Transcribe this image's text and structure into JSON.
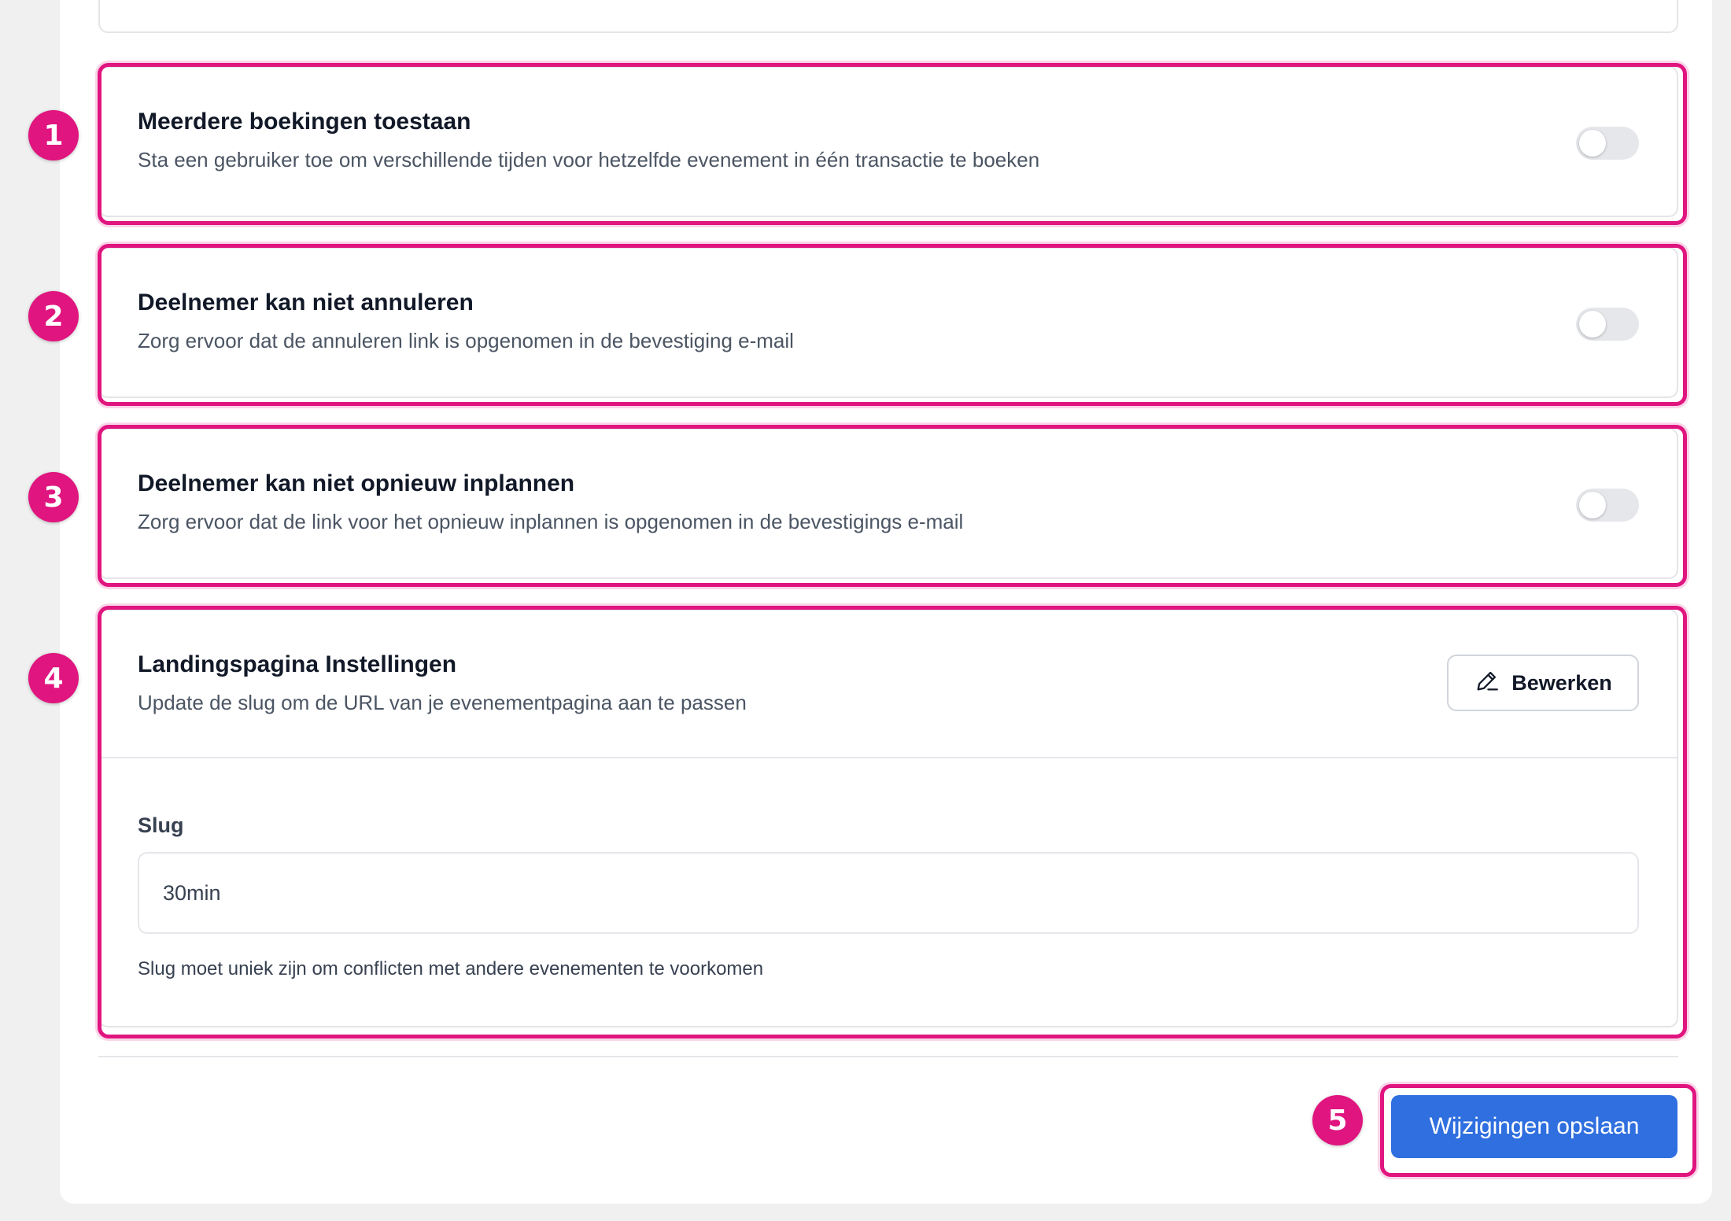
{
  "settings": [
    {
      "badge": "1",
      "title": "Meerdere boekingen toestaan",
      "description": "Sta een gebruiker toe om verschillende tijden voor hetzelfde evenement in één transactie te boeken",
      "enabled": false
    },
    {
      "badge": "2",
      "title": "Deelnemer kan niet annuleren",
      "description": "Zorg ervoor dat de annuleren link is opgenomen in de bevestiging e-mail",
      "enabled": false
    },
    {
      "badge": "3",
      "title": "Deelnemer kan niet opnieuw inplannen",
      "description": "Zorg ervoor dat de link voor het opnieuw inplannen is opgenomen in de bevestigings e-mail",
      "enabled": false
    }
  ],
  "landing": {
    "badge": "4",
    "title": "Landingspagina Instellingen",
    "description": "Update de slug om de URL van je evenementpagina aan te passen",
    "edit_label": "Bewerken",
    "slug_label": "Slug",
    "slug_value": "30min",
    "slug_hint": "Slug moet uniek zijn om conflicten met andere evenementen te voorkomen"
  },
  "footer": {
    "badge": "5",
    "save_label": "Wijzigingen opslaan"
  },
  "colors": {
    "highlight": "#e0157f",
    "primary_button": "#2f6fdf",
    "toggle_off": "#e5e7eb"
  }
}
